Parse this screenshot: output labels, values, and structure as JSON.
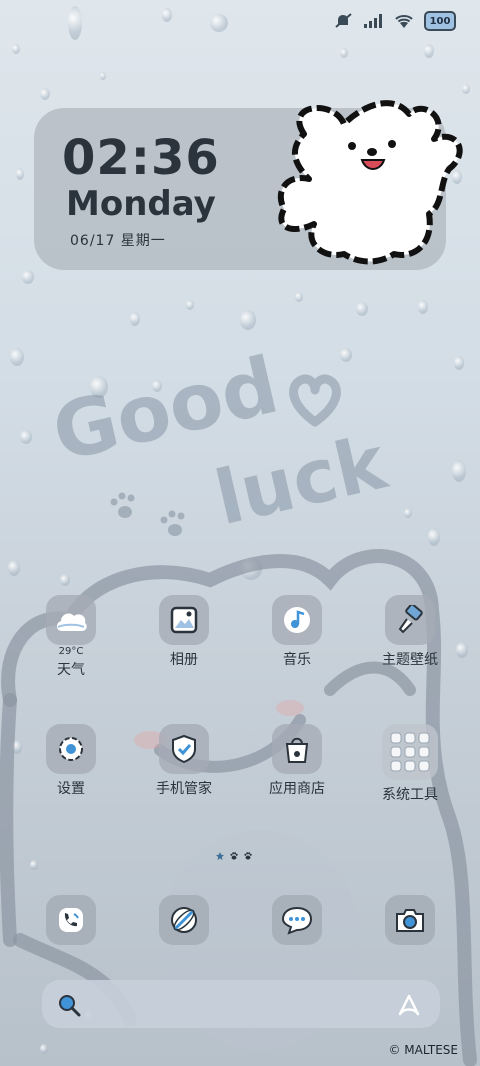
{
  "status_bar": {
    "battery": "100"
  },
  "clock_widget": {
    "time": "02:36",
    "weekday": "Monday",
    "date": "06/17 星期一"
  },
  "wallpaper": {
    "deco_text_1": "Good",
    "deco_text_2": "luck"
  },
  "apps": [
    {
      "label": "天气",
      "sub": "29°C",
      "icon": "weather-cloud-icon"
    },
    {
      "label": "相册",
      "icon": "gallery-icon"
    },
    {
      "label": "音乐",
      "icon": "music-icon"
    },
    {
      "label": "主题壁纸",
      "icon": "theme-brush-icon"
    },
    {
      "label": "设置",
      "icon": "settings-gear-icon"
    },
    {
      "label": "手机管家",
      "icon": "security-shield-icon"
    },
    {
      "label": "应用商店",
      "icon": "app-store-bag-icon"
    },
    {
      "label": "系统工具",
      "icon": "system-tools-folder-icon"
    }
  ],
  "dock": [
    "phone-icon",
    "browser-icon",
    "messages-icon",
    "camera-icon"
  ],
  "colors": {
    "accent": "#3f93d6",
    "icon_bg": "#a5acb6",
    "text": "#2b343c"
  },
  "copyright": "© MALTESE"
}
